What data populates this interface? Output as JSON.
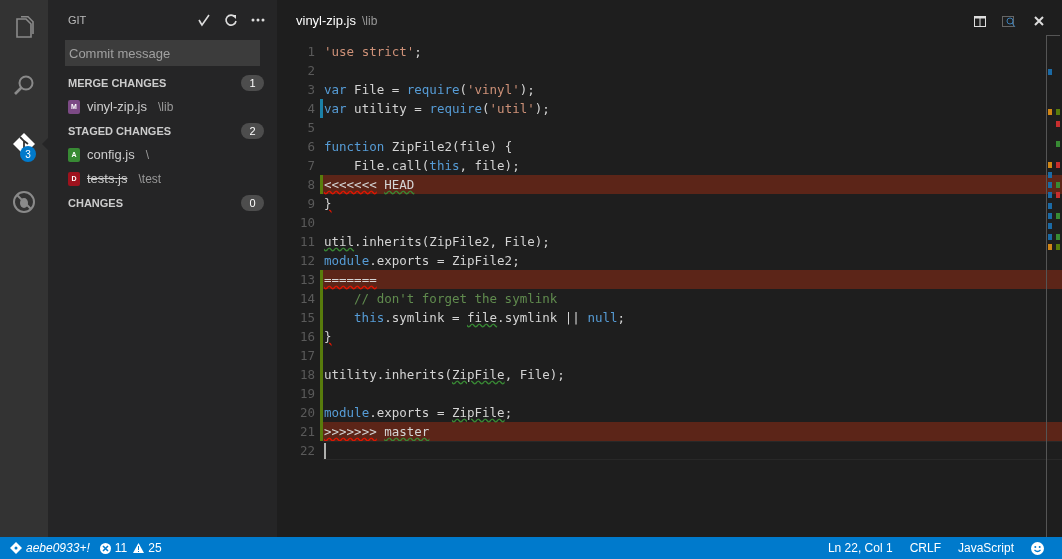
{
  "activity_bar": [
    {
      "selected": false
    },
    {
      "selected": false
    },
    {
      "selected": true,
      "badge": "3"
    },
    {
      "selected": false
    }
  ],
  "sidebar": {
    "title": "GIT",
    "commit_placeholder": "Commit message",
    "groups": [
      {
        "title": "MERGE CHANGES",
        "count": "1",
        "files": [
          {
            "letter": "M",
            "color": "#7c4a85",
            "name": "vinyl-zip.js",
            "path": "\\lib",
            "deleted": false
          }
        ]
      },
      {
        "title": "STAGED CHANGES",
        "count": "2",
        "files": [
          {
            "letter": "A",
            "color": "#388a34",
            "name": "config.js",
            "path": "\\",
            "deleted": false
          },
          {
            "letter": "D",
            "color": "#9e121d",
            "name": "tests.js",
            "path": "\\test",
            "deleted": true
          }
        ]
      },
      {
        "title": "CHANGES",
        "count": "0"
      }
    ]
  },
  "editor": {
    "tab": {
      "name": "vinyl-zip.js",
      "path": "\\lib"
    },
    "lines": [
      {
        "number": "1",
        "modified": false,
        "added": false,
        "conflict": false,
        "current": false,
        "indented": false,
        "tokens": [
          {
            "text": "'use strict'",
            "kind": "string"
          },
          {
            "text": ";",
            "kind": "plain"
          }
        ]
      },
      {
        "number": "2",
        "modified": false,
        "added": false,
        "conflict": false,
        "current": false
      },
      {
        "number": "3",
        "modified": false,
        "added": false,
        "conflict": false,
        "current": false,
        "indented": false,
        "tokens": [
          {
            "text": "var",
            "kind": "keyword"
          },
          {
            "text": " File = ",
            "kind": "plain"
          },
          {
            "text": "require",
            "kind": "keyword"
          },
          {
            "text": "(",
            "kind": "plain"
          },
          {
            "text": "'vinyl'",
            "kind": "string"
          },
          {
            "text": ");",
            "kind": "plain"
          }
        ]
      },
      {
        "number": "4",
        "modified": true,
        "conflict": false,
        "current": false,
        "indented": false,
        "tokens": [
          {
            "text": "var",
            "kind": "keyword"
          },
          {
            "text": " utility = ",
            "kind": "plain"
          },
          {
            "text": "require",
            "kind": "keyword"
          },
          {
            "text": "(",
            "kind": "plain"
          },
          {
            "text": "'util'",
            "kind": "string"
          },
          {
            "text": ");",
            "kind": "plain"
          }
        ]
      },
      {
        "number": "5",
        "modified": false,
        "added": false,
        "conflict": false,
        "current": false
      },
      {
        "number": "6",
        "modified": false,
        "added": false,
        "conflict": false,
        "current": false,
        "indented": false,
        "tokens": [
          {
            "text": "function",
            "kind": "keyword"
          },
          {
            "text": " ZipFile2(file) {",
            "kind": "plain"
          }
        ]
      },
      {
        "number": "7",
        "modified": false,
        "added": false,
        "conflict": false,
        "current": false,
        "indented": true,
        "tokens": [
          {
            "text": "File.call(",
            "kind": "plain"
          },
          {
            "text": "this",
            "kind": "keyword"
          },
          {
            "text": ", file);",
            "kind": "plain"
          }
        ]
      },
      {
        "number": "8",
        "modified": false,
        "added": true,
        "conflict": true,
        "current": false,
        "indented": false,
        "tokens": [
          {
            "text": "<<<<<<<",
            "kind": "plain",
            "error_squiggle": true
          },
          {
            "text": "HEAD",
            "kind": "plain",
            "warning_squiggle": true,
            "space_before": true
          }
        ]
      },
      {
        "number": "9",
        "modified": false,
        "added": false,
        "conflict": false,
        "current": false,
        "indented": false,
        "tokens": [
          {
            "text": "}",
            "kind": "plain",
            "error_squiggle": true
          }
        ]
      },
      {
        "number": "10",
        "modified": false,
        "added": false,
        "conflict": false,
        "current": false
      },
      {
        "number": "11",
        "modified": false,
        "added": false,
        "conflict": false,
        "current": false,
        "indented": false,
        "tokens": [
          {
            "text": "util",
            "kind": "plain",
            "warning_squiggle": true
          },
          {
            "text": ".inherits(ZipFile2, File);",
            "kind": "plain"
          }
        ]
      },
      {
        "number": "12",
        "modified": false,
        "added": false,
        "conflict": false,
        "current": false,
        "indented": false,
        "tokens": [
          {
            "text": "module",
            "kind": "keyword"
          },
          {
            "text": ".exports = ZipFile2;",
            "kind": "plain"
          }
        ]
      },
      {
        "number": "13",
        "modified": false,
        "added": true,
        "conflict": true,
        "current": false,
        "indented": false,
        "tokens": [
          {
            "text": "=======",
            "kind": "plain",
            "error_squiggle": true
          }
        ]
      },
      {
        "number": "14",
        "modified": false,
        "added": true,
        "conflict": false,
        "current": false,
        "indented": true,
        "tokens": [
          {
            "text": "// don't forget the symlink",
            "kind": "comment"
          }
        ]
      },
      {
        "number": "15",
        "modified": false,
        "added": true,
        "conflict": false,
        "current": false,
        "indented": true,
        "tokens": [
          {
            "text": "this",
            "kind": "keyword"
          },
          {
            "text": ".symlink = ",
            "kind": "plain"
          },
          {
            "text": "file",
            "kind": "plain",
            "warning_squiggle": true
          },
          {
            "text": ".symlink || ",
            "kind": "plain"
          },
          {
            "text": "null",
            "kind": "keyword"
          },
          {
            "text": ";",
            "kind": "plain"
          }
        ]
      },
      {
        "number": "16",
        "modified": false,
        "added": true,
        "conflict": false,
        "current": false,
        "indented": false,
        "tokens": [
          {
            "text": "}",
            "kind": "plain",
            "error_squiggle": true
          }
        ]
      },
      {
        "number": "17",
        "modified": false,
        "added": true,
        "conflict": false,
        "current": false
      },
      {
        "number": "18",
        "modified": false,
        "added": true,
        "conflict": false,
        "current": false,
        "indented": false,
        "tokens": [
          {
            "text": "utility.inherits(",
            "kind": "plain"
          },
          {
            "text": "ZipFile",
            "kind": "plain",
            "warning_squiggle": true
          },
          {
            "text": ", File);",
            "kind": "plain"
          }
        ]
      },
      {
        "number": "19",
        "modified": false,
        "added": true,
        "conflict": false,
        "current": false
      },
      {
        "number": "20",
        "modified": false,
        "added": true,
        "conflict": false,
        "current": false,
        "indented": false,
        "tokens": [
          {
            "text": "module",
            "kind": "keyword"
          },
          {
            "text": ".exports = ",
            "kind": "plain"
          },
          {
            "text": "ZipFile",
            "kind": "plain",
            "warning_squiggle": true
          },
          {
            "text": ";",
            "kind": "plain"
          }
        ]
      },
      {
        "number": "21",
        "modified": false,
        "added": true,
        "conflict": true,
        "current": false,
        "indented": false,
        "tokens": [
          {
            "text": ">>>>>>>",
            "kind": "plain",
            "error_squiggle": true
          },
          {
            "text": "master",
            "kind": "plain",
            "warning_squiggle": true,
            "space_before": true
          }
        ]
      },
      {
        "number": "22",
        "modified": false,
        "added": false,
        "conflict": false,
        "current": true
      }
    ]
  },
  "status_bar": {
    "branch": "aebe0933+!",
    "errors": "11",
    "warnings": "25",
    "position": "Ln 22, Col 1",
    "eol": "CRLF",
    "language": "JavaScript"
  }
}
